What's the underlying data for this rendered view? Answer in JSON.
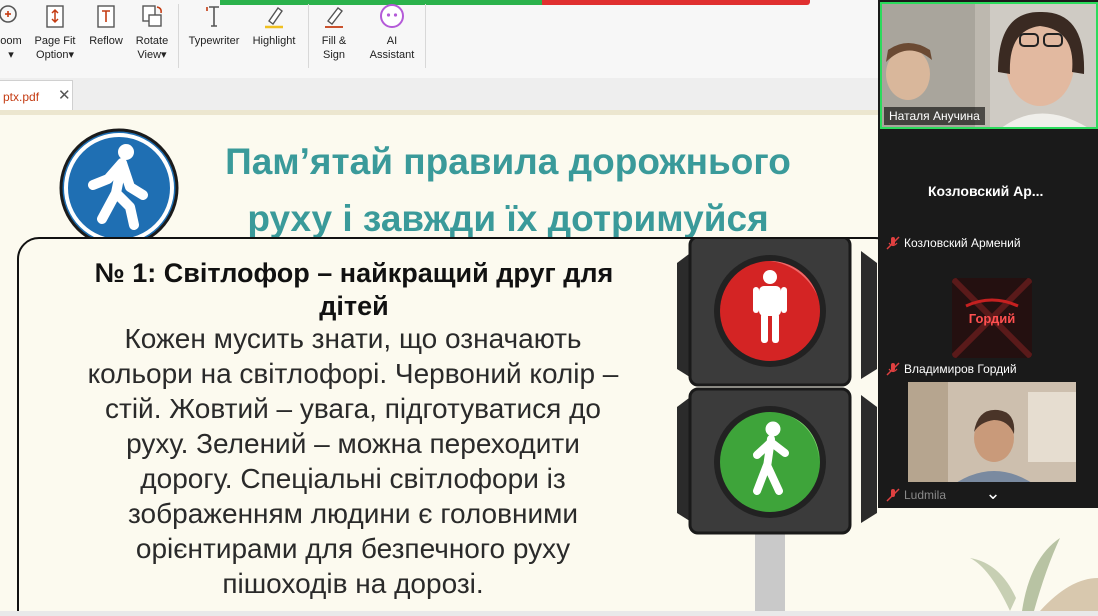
{
  "toolbar": {
    "items": [
      {
        "label1": "oom",
        "label2": "▾",
        "icon": "zoom-icon"
      },
      {
        "label1": "Page Fit",
        "label2": "Option▾",
        "icon": "page-fit-icon"
      },
      {
        "label1": "Reflow",
        "label2": "",
        "icon": "reflow-icon"
      },
      {
        "label1": "Rotate",
        "label2": "View▾",
        "icon": "rotate-icon"
      },
      {
        "label1": "Typewriter",
        "label2": "",
        "icon": "typewriter-icon"
      },
      {
        "label1": "Highlight",
        "label2": "",
        "icon": "highlight-icon"
      },
      {
        "label1": "Fill &",
        "label2": "Sign",
        "icon": "fill-sign-icon"
      },
      {
        "label1": "AI",
        "label2": "Assistant",
        "icon": "ai-assistant-icon"
      }
    ],
    "colors": {
      "accent": "#c43b12",
      "progress_green": "#2bb24c",
      "progress_red": "#e03030"
    }
  },
  "tab": {
    "name": "ptx.pdf",
    "close": "✕"
  },
  "slide": {
    "title_line1": "Пам’ятай правила дорожнього",
    "title_line2": "руху і завжди їх дотримуйся",
    "heading_line1": "№ 1: Світлофор – найкращий друг для",
    "heading_line2": "дітей",
    "body_lines": [
      "Кожен мусить знати, що означають",
      "кольори на світлофорі. Червоний колір –",
      "стій. Жовтий – увага, підготуватися до",
      "руху. Зелений – можна переходити",
      "дорогу. Спеціальні світлофори із",
      "зображенням людини є головними",
      "орієнтирами для безпечного руху",
      "пішоходів на дорозі."
    ],
    "colors": {
      "title": "#3a9a9a",
      "sign_blue": "#1f6fb3",
      "red_light": "#d42424",
      "green_light": "#3ea43a"
    }
  },
  "participants": {
    "speaker_name": "Наталя Анучина",
    "tile2_title": "Козловский  Ар...",
    "tile2_name": "Козловский Армений",
    "tile3_avatar_text": "Гордий",
    "tile3_name": "Владимиров Гордий",
    "tile4_name": "Ludmila",
    "more": "⌄"
  }
}
